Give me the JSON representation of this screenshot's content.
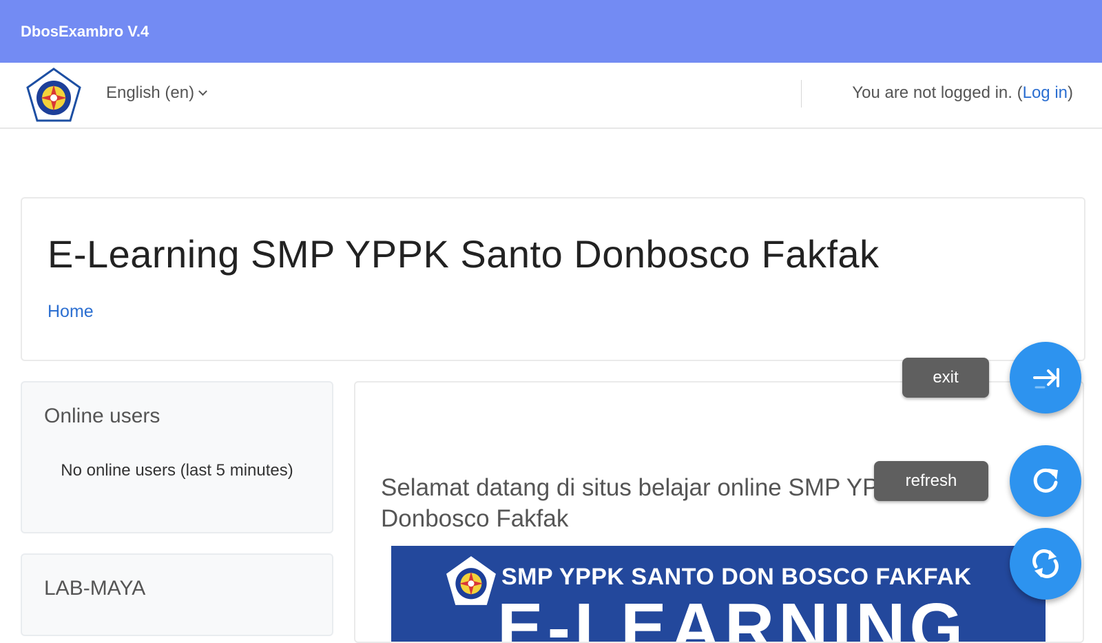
{
  "app": {
    "title": "DbosExambro V.4"
  },
  "navbar": {
    "language": "English (en)",
    "login_text": "You are not logged in. (",
    "login_link": "Log in",
    "login_close": ")"
  },
  "header": {
    "title": "E-Learning SMP YPPK Santo Donbosco Fakfak",
    "breadcrumb_home": "Home"
  },
  "blocks": [
    {
      "title": "Online users",
      "text": "No online users (last 5 minutes)"
    },
    {
      "title": "LAB-MAYA"
    }
  ],
  "main": {
    "welcome": "Selamat datang di situs belajar online SMP YPPK Santo Donbosco Fakfak",
    "banner_line": "SMP YPPK SANTO DON BOSCO FAKFAK",
    "banner_big": "E-LEARNING"
  },
  "floating": {
    "exit_label": "exit",
    "refresh_label": "refresh"
  },
  "colors": {
    "appbar": "#738bf3",
    "fab": "#2d93ef",
    "link": "#2c6fd1",
    "banner": "#23489c"
  }
}
